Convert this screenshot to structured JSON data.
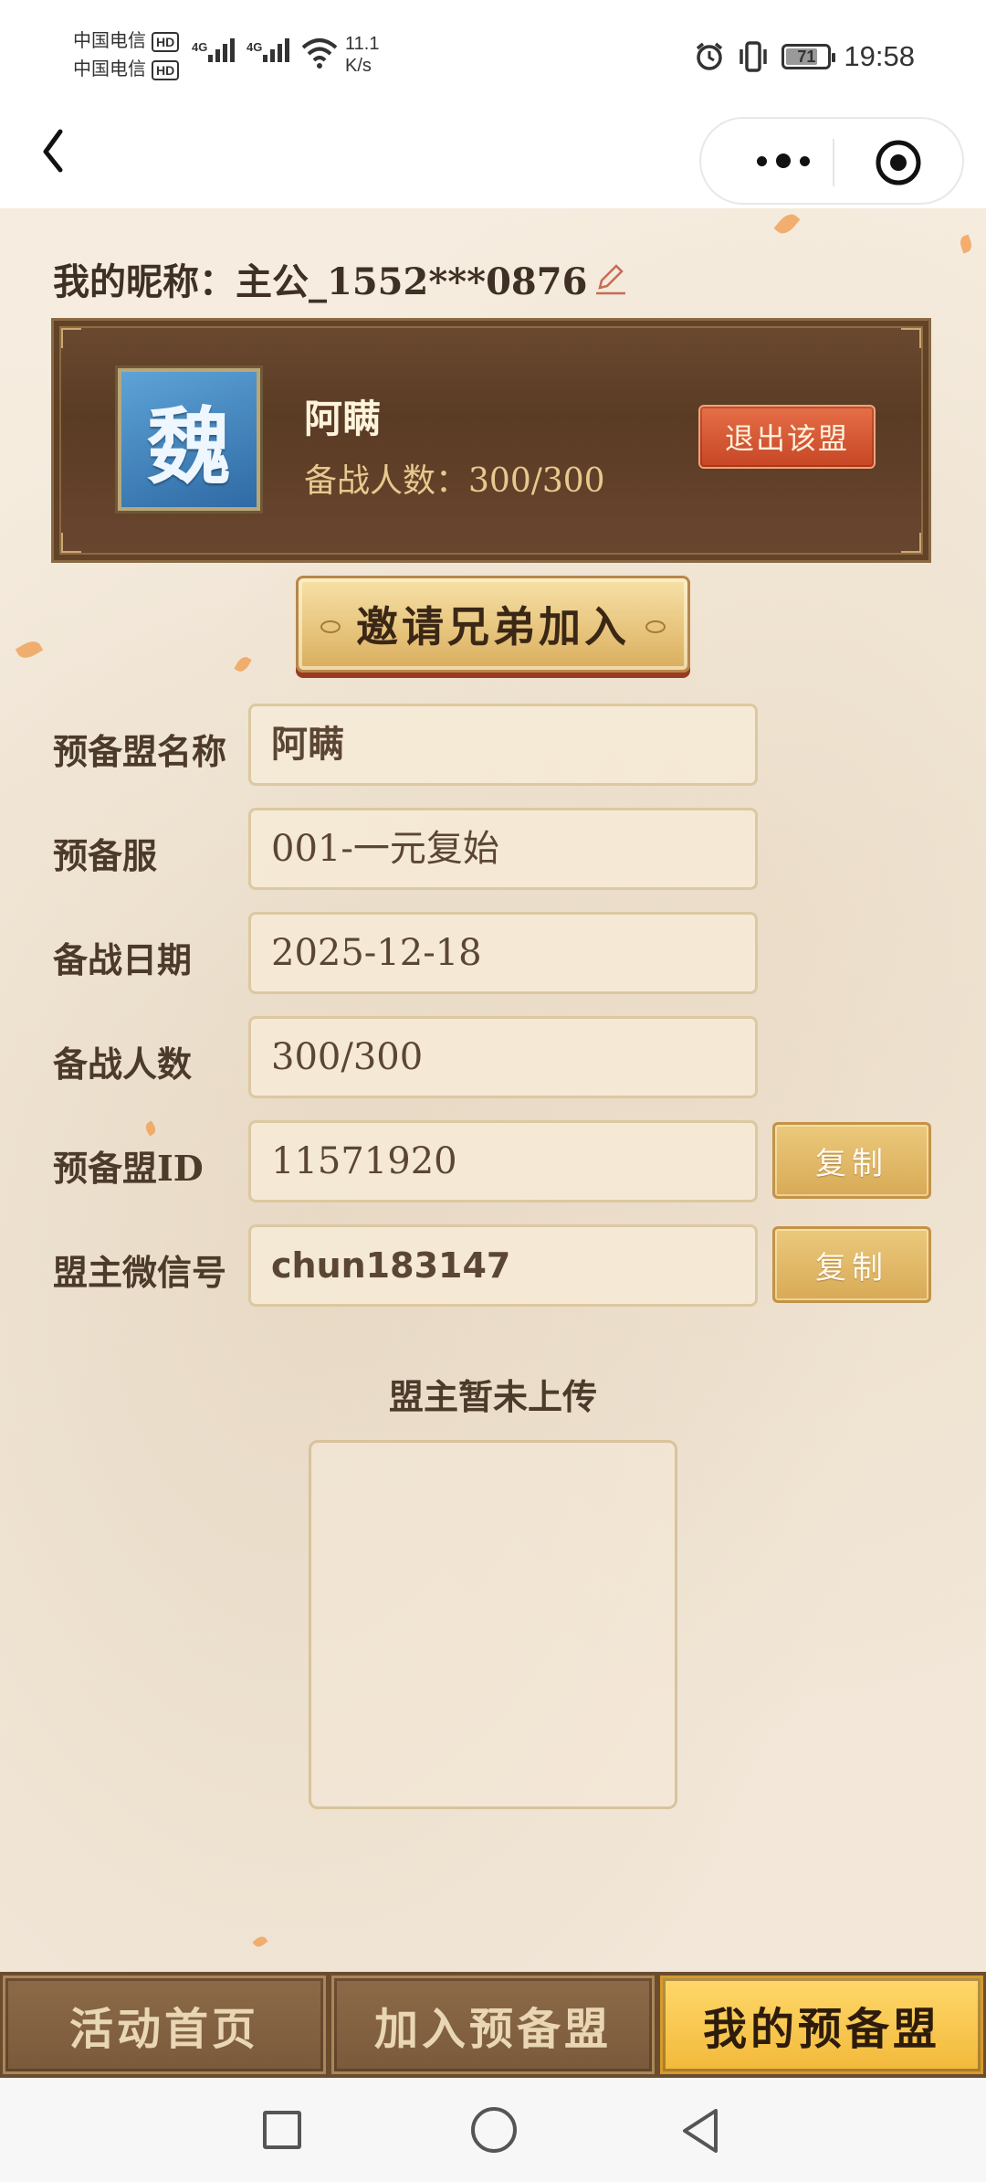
{
  "status_bar": {
    "carrier1": "中国电信",
    "carrier2": "中国电信",
    "hd_label": "HD",
    "network1": "4G",
    "network2": "4G",
    "speed_value": "11.1",
    "speed_unit": "K/s",
    "battery": "71",
    "time": "19:58"
  },
  "nav": {
    "back_icon": "chevron-left-icon",
    "more_icon": "more-dots-icon",
    "close_icon": "target-circle-icon"
  },
  "profile": {
    "nickname_label": "我的昵称：",
    "nickname_value": "主公_1552***0876",
    "edit_icon": "pencil-icon"
  },
  "alliance": {
    "emblem_char": "魏",
    "name": "阿瞒",
    "count_label": "备战人数：",
    "count_value": "300/300",
    "leave_label": "退出该盟"
  },
  "invite_label": "邀请兄弟加入",
  "form": {
    "name_label": "预备盟名称",
    "name_value": "阿瞒",
    "server_label": "预备服",
    "server_value": "001-一元复始",
    "date_label": "备战日期",
    "date_value": "2025-12-18",
    "members_label": "备战人数",
    "members_value": "300/300",
    "id_label": "预备盟ID",
    "id_value": "11571920",
    "wechat_label": "盟主微信号",
    "wechat_value": "chun183147",
    "copy_label": "复制"
  },
  "upload": {
    "caption": "盟主暂未上传"
  },
  "tabs": {
    "home": "活动首页",
    "join": "加入预备盟",
    "mine": "我的预备盟",
    "active": "mine"
  },
  "colors": {
    "accent_gold": "#f2b93a",
    "card_brown": "#5a3b24",
    "leave_red": "#c74625",
    "page_bg": "#f3e8d9"
  }
}
